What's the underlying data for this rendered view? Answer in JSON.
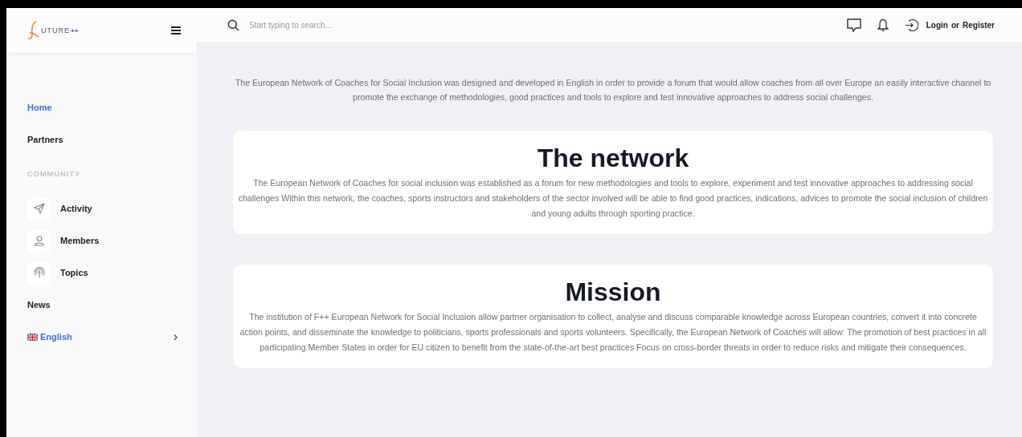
{
  "logo": {
    "text": "UTURE",
    "suffix": "++"
  },
  "search": {
    "placeholder": "Start typing to search..."
  },
  "auth": {
    "login": "Login",
    "or": "or",
    "register": "Register"
  },
  "sidebar": {
    "items": [
      {
        "kind": "link",
        "label": "Home",
        "selected": true
      },
      {
        "kind": "link",
        "label": "Partners",
        "selected": false
      },
      {
        "kind": "section",
        "label": "COMMUNITY"
      },
      {
        "kind": "icon-link",
        "label": "Activity",
        "selected": false
      },
      {
        "kind": "icon-link",
        "label": "Members",
        "selected": false
      },
      {
        "kind": "icon-link",
        "label": "Topics",
        "selected": false
      },
      {
        "kind": "link",
        "label": "News",
        "selected": false
      },
      {
        "kind": "language",
        "label": "English",
        "chevron": "›"
      }
    ]
  },
  "intro": "The European Network of Coaches for Social Inclusion was designed and developed in English in order to provide a forum that would allow coaches from all over Europe an easily interactive channel to promote the exchange of methodologies, good practices and tools to explore and test innovative approaches to address social challenges.",
  "cards": [
    {
      "title": "The network",
      "text": "The European Network of Coaches for social inclusion was established as a forum for new methodologies and tools to explore, experiment and test innovative approaches to addressing social challenges Within this network, the coaches, sports instructors and stakeholders of the sector involved will be able to find good practices, indications, advices to promote the social inclusion of children and young adults through sporting practice."
    },
    {
      "title": "Mission",
      "text": "The institution of F++ European Network for Social Inclusion allow partner organisation to collect, analyse and discuss comparable knowledge across European countries, convert it into concrete action points, and disseminate the knowledge to politicians, sports professionals and sports volunteers. Specifically, the European Network of Coaches will allow:  The promotion of best practices in all participating Member States in order for EU citizen to benefit from the state-of-the-art best practices  Focus on cross-border threats in order to reduce risks and mitigate their consequences."
    }
  ]
}
